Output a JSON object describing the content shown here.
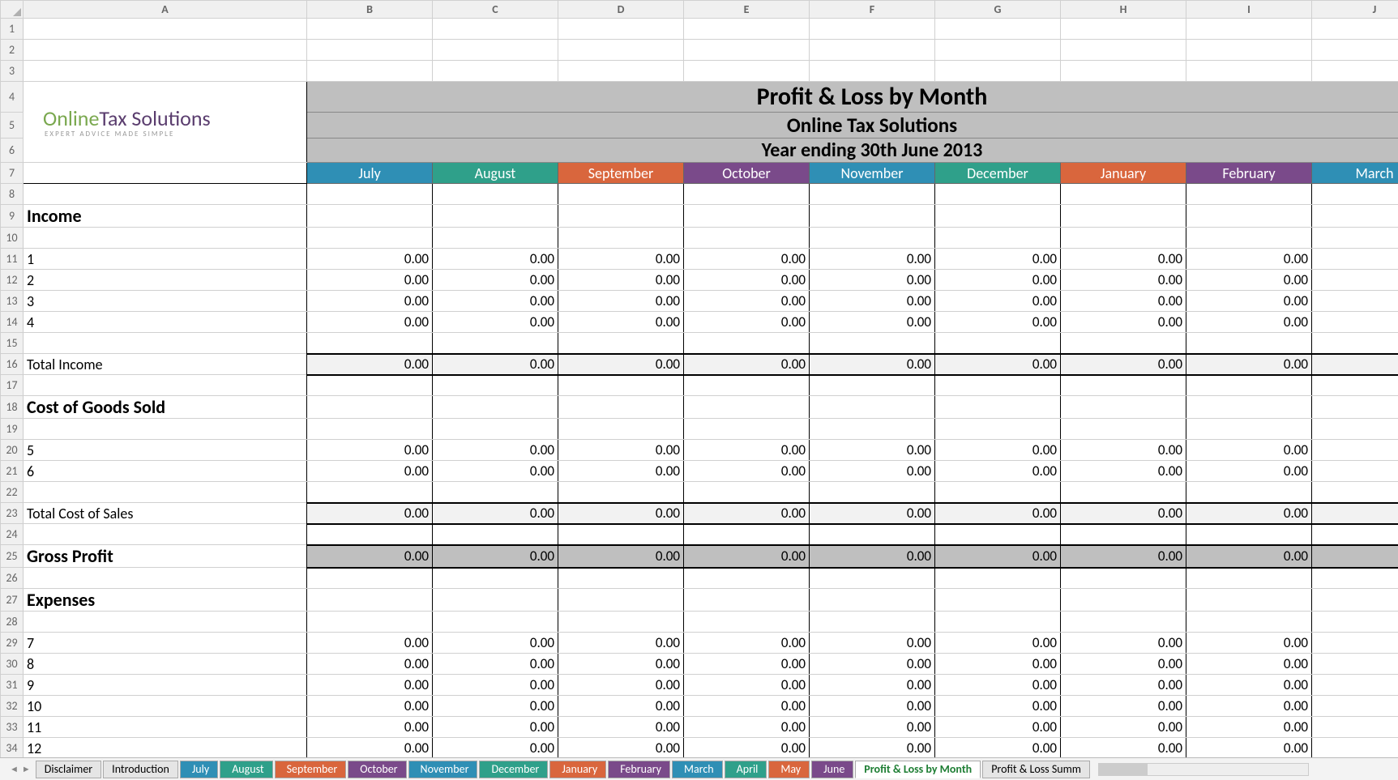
{
  "columns": [
    "A",
    "B",
    "C",
    "D",
    "E",
    "F",
    "G",
    "H",
    "I",
    "J"
  ],
  "title": {
    "line1": "Profit & Loss by Month",
    "line2": "Online Tax Solutions",
    "line3": "Year ending 30th June 2013"
  },
  "logo": {
    "prefix": "Online",
    "mid": "Tax",
    "suffix": " Solutions",
    "tag": "EXPERT ADVICE MADE SIMPLE"
  },
  "months": [
    {
      "name": "July",
      "color": "#2f8fb5"
    },
    {
      "name": "August",
      "color": "#2fa08a"
    },
    {
      "name": "September",
      "color": "#d9663d"
    },
    {
      "name": "October",
      "color": "#7a4a8a"
    },
    {
      "name": "November",
      "color": "#2f8fb5"
    },
    {
      "name": "December",
      "color": "#2fa08a"
    },
    {
      "name": "January",
      "color": "#d9663d"
    },
    {
      "name": "February",
      "color": "#7a4a8a"
    },
    {
      "name": "March",
      "color": "#2f8fb5"
    }
  ],
  "sections": {
    "income": {
      "label": "Income",
      "rows": [
        "1",
        "2",
        "3",
        "4"
      ],
      "total_label": "Total Income"
    },
    "cogs": {
      "label": "Cost of Goods Sold",
      "rows": [
        "5",
        "6"
      ],
      "total_label": "Total Cost of Sales"
    },
    "gross": {
      "label": "Gross Profit"
    },
    "expenses": {
      "label": "Expenses",
      "rows": [
        "7",
        "8",
        "9",
        "10",
        "11",
        "12"
      ]
    }
  },
  "zero": "0.00",
  "tabs": [
    {
      "label": "Disclaimer",
      "color": null
    },
    {
      "label": "Introduction",
      "color": null
    },
    {
      "label": "July",
      "color": "#2f8fb5"
    },
    {
      "label": "August",
      "color": "#2fa08a"
    },
    {
      "label": "September",
      "color": "#d9663d"
    },
    {
      "label": "October",
      "color": "#7a4a8a"
    },
    {
      "label": "November",
      "color": "#2f8fb5"
    },
    {
      "label": "December",
      "color": "#2fa08a"
    },
    {
      "label": "January",
      "color": "#d9663d"
    },
    {
      "label": "February",
      "color": "#7a4a8a"
    },
    {
      "label": "March",
      "color": "#2f8fb5"
    },
    {
      "label": "April",
      "color": "#2fa08a"
    },
    {
      "label": "May",
      "color": "#d9663d"
    },
    {
      "label": "June",
      "color": "#7a4a8a"
    },
    {
      "label": "Profit & Loss by Month",
      "color": null,
      "active": true
    },
    {
      "label": "Profit & Loss Summ",
      "color": null
    }
  ]
}
